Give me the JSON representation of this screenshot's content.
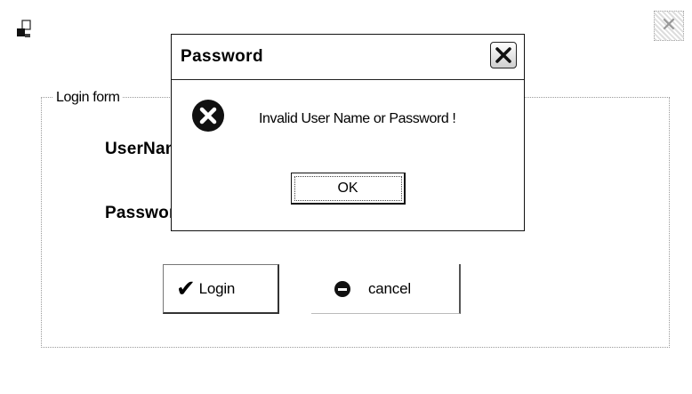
{
  "window": {
    "icon": "app-window-icon",
    "close_icon": "close-icon"
  },
  "form": {
    "group_label": "Login form",
    "username_label": "UserName",
    "password_label": "Password",
    "login_button": "Login",
    "login_icon": "checkmark-icon",
    "cancel_button": "cancel",
    "cancel_icon": "stop-icon"
  },
  "dialog": {
    "title": "Password",
    "message": "Invalid User Name or Password !",
    "ok_button": "OK",
    "message_icon": "error-icon",
    "close_icon": "close-icon"
  }
}
